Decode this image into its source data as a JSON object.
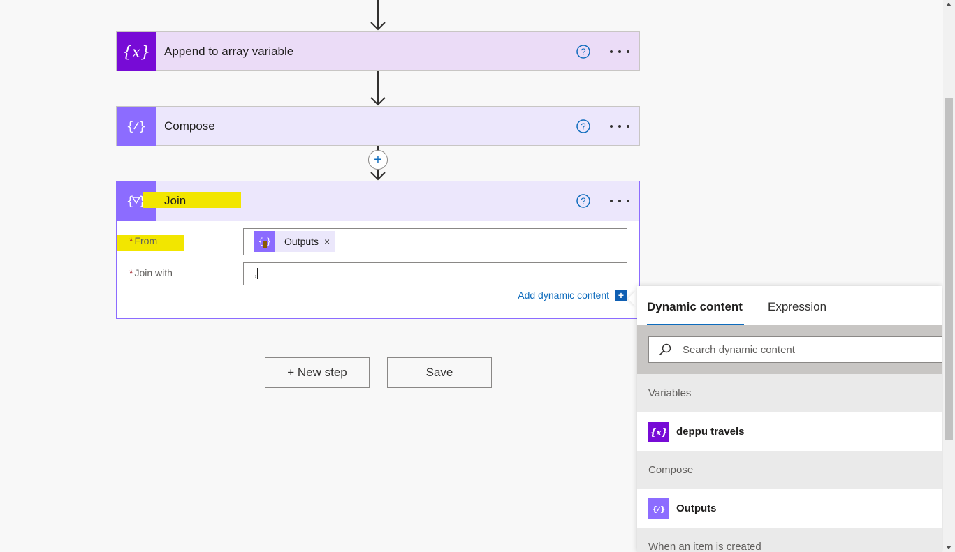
{
  "cards": {
    "append": {
      "title": "Append to array variable"
    },
    "compose": {
      "title": "Compose"
    },
    "join": {
      "title": "Join",
      "fields": {
        "from": {
          "required_mark": "*",
          "label": "From",
          "token_label": "Outputs",
          "token_remove": "×"
        },
        "join_with": {
          "required_mark": "*",
          "label": "Join with",
          "value": ","
        }
      },
      "add_dynamic_label": "Add dynamic content",
      "add_dynamic_icon": "+"
    }
  },
  "insert_step_icon": "+",
  "buttons": {
    "new_step": "+ New step",
    "save": "Save"
  },
  "dynamic_panel": {
    "tabs": [
      {
        "label": "Dynamic content",
        "active": true
      },
      {
        "label": "Expression",
        "active": false
      }
    ],
    "search_placeholder": "Search dynamic content",
    "sections": [
      {
        "header": "Variables",
        "items": [
          {
            "label": "deppu travels",
            "icon": "variable-icon",
            "color": "#770bd6"
          }
        ]
      },
      {
        "header": "Compose",
        "items": [
          {
            "label": "Outputs",
            "icon": "compose-icon",
            "color": "#8c6cff"
          }
        ]
      },
      {
        "header": "When an item is created",
        "items": []
      }
    ]
  },
  "colors": {
    "variable": "#770bd6",
    "compose": "#8c6cff",
    "highlight": "#f2e600",
    "link": "#0f6cbd"
  }
}
